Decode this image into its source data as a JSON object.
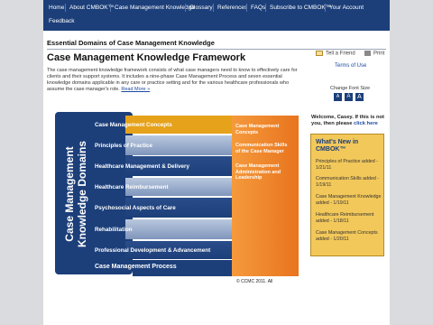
{
  "nav": {
    "items": [
      "Home",
      "About CMBOK™",
      "Case Management Knowledge",
      "Glossary",
      "References",
      "FAQs",
      "Subscribe to CMBOK™",
      "Your Account"
    ],
    "second_row": "Feedback"
  },
  "breadcrumb": "Essential Domains of Case Management Knowledge",
  "page_title": "Case Management Knowledge Framework",
  "description": "The case management knowledge framework consists of what case managers need to know to effectively care for clients and their support systems. It includes a nine-phase Case Management Process and seven essential knowledge domains applicable in any care or practice setting and for the various healthcare professionals who assume the case manager's role.",
  "read_more": "Read More »",
  "tools": {
    "tell_friend": "Tell a Friend",
    "print": "Print",
    "terms": "Terms of Use",
    "change_font_size": "Change Font Size",
    "font_buttons": [
      "A",
      "A",
      "A"
    ]
  },
  "diagram": {
    "vertical_label_line1": "Case Management",
    "vertical_label_line2": "Knowledge Domains",
    "domains": [
      "Case Management Concepts",
      "Principles of Practice",
      "Healthcare Management & Delivery",
      "Healthcare Reimbursement",
      "Psychosocial Aspects of Care",
      "Rehabilitation",
      "Professional Development & Advancement"
    ],
    "process_label": "Case Management Process",
    "orange_items": [
      "Case Management Concepts",
      "Communication Skills of the Case Manager",
      "Case Management Administration and Leadership"
    ],
    "copyright": "© CCMC 2011. All",
    "colors": {
      "orange": "#f0812a",
      "highlight": "#e6a21a",
      "band_dark": "#1c3f7a",
      "band_light": "#8ea4c6"
    }
  },
  "sidebar": {
    "welcome_text": "Welcome, Casey. If this is not you, then please",
    "welcome_link": "click here",
    "news_title": "What's New in CMBOK™",
    "news": [
      "Principles of Practice added - 1/21/11",
      "Communication Skills added - 1/19/11",
      "Case Management Knowledge added - 1/19/11",
      "Healthcare Reimbursement added - 1/18/11",
      "Case Management Concepts added - 1/20/11"
    ]
  }
}
